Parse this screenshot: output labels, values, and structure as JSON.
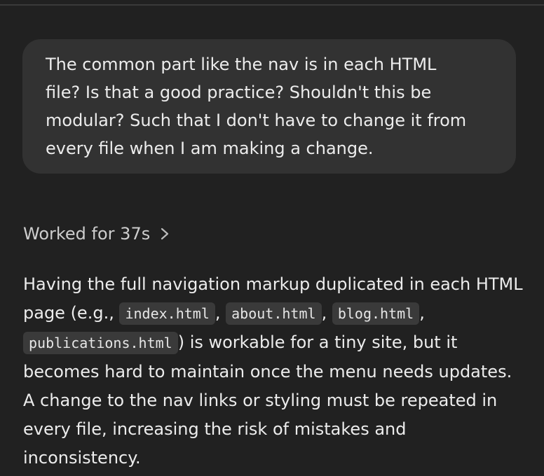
{
  "user_message": {
    "text": "The common part like the nav is in each HTML\nfile? Is that a good practice? Shouldn't this be\nmodular? Such that I don't have to change it from\nevery file when I am making a change."
  },
  "worked": {
    "label": "Worked for 37s",
    "icon": "chevron-right-icon"
  },
  "answer": {
    "part1": "Having the full navigation markup duplicated in each HTML page (e.g., ",
    "code1": "index.html",
    "sep1": ", ",
    "code2": "about.html",
    "sep2": ", ",
    "code3": "blog.html",
    "sep3": ", ",
    "code4": "publications.html",
    "part2": ") is workable for a tiny site, but it becomes hard to maintain once the menu needs updates. A change to the nav links or styling must be repeated in every file, increasing the risk of mistakes and inconsistency."
  }
}
